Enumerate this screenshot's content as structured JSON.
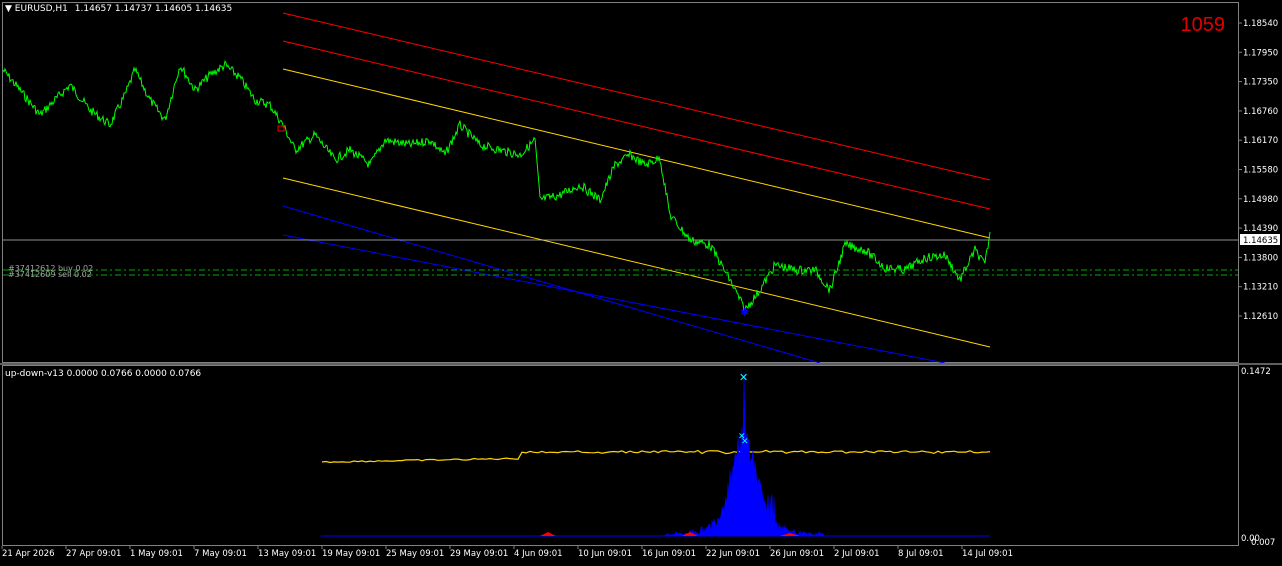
{
  "main_chart": {
    "header": {
      "symbol_tf": "EURUSD,H1",
      "ohlc": "1.14657 1.14737 1.14605 1.14635"
    },
    "counter": "1059",
    "price_ticks": [
      "1.18540",
      "1.17950",
      "1.17350",
      "1.16760",
      "1.16170",
      "1.15580",
      "1.14980",
      "1.14390",
      "1.13800",
      "1.13210",
      "1.12610"
    ],
    "current_price": "1.14635",
    "order_lines": [
      "#37412612 buy 0.02",
      "#37412609 sell 0.02"
    ],
    "colors": {
      "price": "#00ff00",
      "channel_red": "#ff0000",
      "channel_yellow": "#ffd700",
      "channel_blue": "#0000ff",
      "order_line": "#00aa00",
      "bid_line": "#c0c0c0"
    }
  },
  "indicator": {
    "label": "up-down-v13 0.0000 0.0766 0.0000 0.0766",
    "ticks": [
      "0.1472",
      "0.00",
      "0.007"
    ],
    "colors": {
      "histogram": "#0000ff",
      "signal": "#ffd700",
      "marker": "#00ffff",
      "red": "#ff0000"
    }
  },
  "time_axis": [
    "21 Apr 2026",
    "27 Apr 09:01",
    "1 May 09:01",
    "7 May 09:01",
    "13 May 09:01",
    "19 May 09:01",
    "25 May 09:01",
    "29 May 09:01",
    "4 Jun 09:01",
    "10 Jun 09:01",
    "16 Jun 09:01",
    "22 Jun 09:01",
    "26 Jun 09:01",
    "2 Jul 09:01",
    "8 Jul 09:01",
    "14 Jul 09:01"
  ]
}
